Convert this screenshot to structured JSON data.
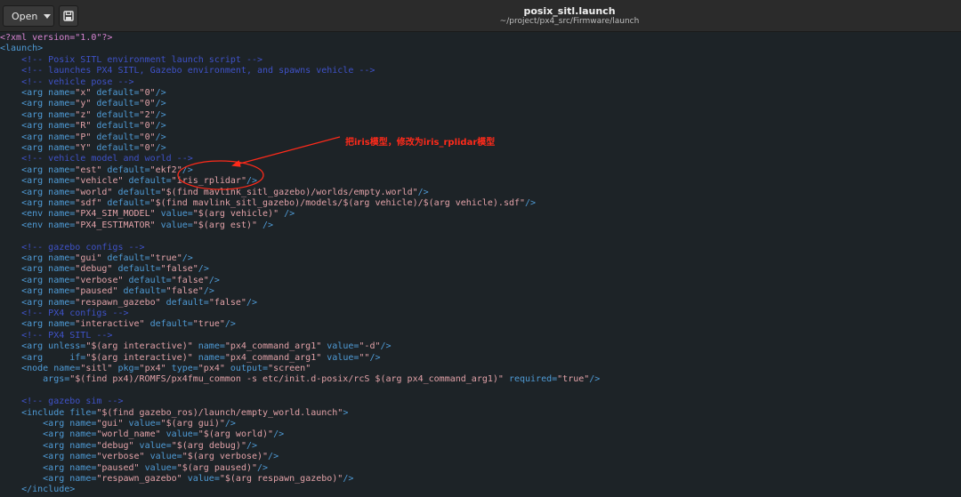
{
  "header": {
    "open_label": "Open",
    "save_icon": "save-icon",
    "title": "posix_sitl.launch",
    "subtitle": "~/project/px4_src/Firmware/launch"
  },
  "annotation": {
    "text": "把iris模型，修改为iris_rplidar模型",
    "color": "#ff2a1a"
  },
  "colors": {
    "background": "#1d2327",
    "tag": "#4f9bd6",
    "value": "#e2a2a8",
    "comment": "#3f52c8",
    "processing_instruction": "#d884d0"
  },
  "lines": [
    {
      "indent": 0,
      "tokens": [
        {
          "c": "pi",
          "t": "<?xml version=\"1.0\"?>"
        }
      ]
    },
    {
      "indent": 0,
      "tokens": [
        {
          "c": "tag",
          "t": "<launch>"
        }
      ]
    },
    {
      "indent": 4,
      "tokens": [
        {
          "c": "comment",
          "t": "<!-- Posix SITL environment launch script -->"
        }
      ]
    },
    {
      "indent": 4,
      "tokens": [
        {
          "c": "comment",
          "t": "<!-- launches PX4 SITL, Gazebo environment, and spawns vehicle -->"
        }
      ]
    },
    {
      "indent": 4,
      "tokens": [
        {
          "c": "comment",
          "t": "<!-- vehicle pose -->"
        }
      ]
    },
    {
      "indent": 4,
      "tokens": [
        {
          "c": "tag",
          "t": "<arg name="
        },
        {
          "c": "val",
          "t": "\"x\""
        },
        {
          "c": "tag",
          "t": " default="
        },
        {
          "c": "val",
          "t": "\"0\""
        },
        {
          "c": "tag",
          "t": "/>"
        }
      ]
    },
    {
      "indent": 4,
      "tokens": [
        {
          "c": "tag",
          "t": "<arg name="
        },
        {
          "c": "val",
          "t": "\"y\""
        },
        {
          "c": "tag",
          "t": " default="
        },
        {
          "c": "val",
          "t": "\"0\""
        },
        {
          "c": "tag",
          "t": "/>"
        }
      ]
    },
    {
      "indent": 4,
      "tokens": [
        {
          "c": "tag",
          "t": "<arg name="
        },
        {
          "c": "val",
          "t": "\"z\""
        },
        {
          "c": "tag",
          "t": " default="
        },
        {
          "c": "val",
          "t": "\"2\""
        },
        {
          "c": "tag",
          "t": "/>"
        }
      ]
    },
    {
      "indent": 4,
      "tokens": [
        {
          "c": "tag",
          "t": "<arg name="
        },
        {
          "c": "val",
          "t": "\"R\""
        },
        {
          "c": "tag",
          "t": " default="
        },
        {
          "c": "val",
          "t": "\"0\""
        },
        {
          "c": "tag",
          "t": "/>"
        }
      ]
    },
    {
      "indent": 4,
      "tokens": [
        {
          "c": "tag",
          "t": "<arg name="
        },
        {
          "c": "val",
          "t": "\"P\""
        },
        {
          "c": "tag",
          "t": " default="
        },
        {
          "c": "val",
          "t": "\"0\""
        },
        {
          "c": "tag",
          "t": "/>"
        }
      ]
    },
    {
      "indent": 4,
      "tokens": [
        {
          "c": "tag",
          "t": "<arg name="
        },
        {
          "c": "val",
          "t": "\"Y\""
        },
        {
          "c": "tag",
          "t": " default="
        },
        {
          "c": "val",
          "t": "\"0\""
        },
        {
          "c": "tag",
          "t": "/>"
        }
      ]
    },
    {
      "indent": 4,
      "tokens": [
        {
          "c": "comment",
          "t": "<!-- vehicle model and world -->"
        }
      ]
    },
    {
      "indent": 4,
      "tokens": [
        {
          "c": "tag",
          "t": "<arg name="
        },
        {
          "c": "val",
          "t": "\"est\""
        },
        {
          "c": "tag",
          "t": " default="
        },
        {
          "c": "val",
          "t": "\"ekf2\""
        },
        {
          "c": "tag",
          "t": "/>"
        }
      ]
    },
    {
      "indent": 4,
      "tokens": [
        {
          "c": "tag",
          "t": "<arg name="
        },
        {
          "c": "val",
          "t": "\"vehicle\""
        },
        {
          "c": "tag",
          "t": " default="
        },
        {
          "c": "val",
          "t": "\"iris_rplidar\""
        },
        {
          "c": "tag",
          "t": "/>"
        }
      ]
    },
    {
      "indent": 4,
      "tokens": [
        {
          "c": "tag",
          "t": "<arg name="
        },
        {
          "c": "val",
          "t": "\"world\""
        },
        {
          "c": "tag",
          "t": " default="
        },
        {
          "c": "val",
          "t": "\"$(find mavlink_sitl_gazebo)/worlds/empty.world\""
        },
        {
          "c": "tag",
          "t": "/>"
        }
      ]
    },
    {
      "indent": 4,
      "tokens": [
        {
          "c": "tag",
          "t": "<arg name="
        },
        {
          "c": "val",
          "t": "\"sdf\""
        },
        {
          "c": "tag",
          "t": " default="
        },
        {
          "c": "val",
          "t": "\"$(find mavlink_sitl_gazebo)/models/$(arg vehicle)/$(arg vehicle).sdf\""
        },
        {
          "c": "tag",
          "t": "/>"
        }
      ]
    },
    {
      "indent": 4,
      "tokens": [
        {
          "c": "tag",
          "t": "<env name="
        },
        {
          "c": "val",
          "t": "\"PX4_SIM_MODEL\""
        },
        {
          "c": "tag",
          "t": " value="
        },
        {
          "c": "val",
          "t": "\"$(arg vehicle)\""
        },
        {
          "c": "tag",
          "t": " />"
        }
      ]
    },
    {
      "indent": 4,
      "tokens": [
        {
          "c": "tag",
          "t": "<env name="
        },
        {
          "c": "val",
          "t": "\"PX4_ESTIMATOR\""
        },
        {
          "c": "tag",
          "t": " value="
        },
        {
          "c": "val",
          "t": "\"$(arg est)\""
        },
        {
          "c": "tag",
          "t": " />"
        }
      ]
    },
    {
      "indent": 0,
      "tokens": []
    },
    {
      "indent": 4,
      "tokens": [
        {
          "c": "comment",
          "t": "<!-- gazebo configs -->"
        }
      ]
    },
    {
      "indent": 4,
      "tokens": [
        {
          "c": "tag",
          "t": "<arg name="
        },
        {
          "c": "val",
          "t": "\"gui\""
        },
        {
          "c": "tag",
          "t": " default="
        },
        {
          "c": "val",
          "t": "\"true\""
        },
        {
          "c": "tag",
          "t": "/>"
        }
      ]
    },
    {
      "indent": 4,
      "tokens": [
        {
          "c": "tag",
          "t": "<arg name="
        },
        {
          "c": "val",
          "t": "\"debug\""
        },
        {
          "c": "tag",
          "t": " default="
        },
        {
          "c": "val",
          "t": "\"false\""
        },
        {
          "c": "tag",
          "t": "/>"
        }
      ]
    },
    {
      "indent": 4,
      "tokens": [
        {
          "c": "tag",
          "t": "<arg name="
        },
        {
          "c": "val",
          "t": "\"verbose\""
        },
        {
          "c": "tag",
          "t": " default="
        },
        {
          "c": "val",
          "t": "\"false\""
        },
        {
          "c": "tag",
          "t": "/>"
        }
      ]
    },
    {
      "indent": 4,
      "tokens": [
        {
          "c": "tag",
          "t": "<arg name="
        },
        {
          "c": "val",
          "t": "\"paused\""
        },
        {
          "c": "tag",
          "t": " default="
        },
        {
          "c": "val",
          "t": "\"false\""
        },
        {
          "c": "tag",
          "t": "/>"
        }
      ]
    },
    {
      "indent": 4,
      "tokens": [
        {
          "c": "tag",
          "t": "<arg name="
        },
        {
          "c": "val",
          "t": "\"respawn_gazebo\""
        },
        {
          "c": "tag",
          "t": " default="
        },
        {
          "c": "val",
          "t": "\"false\""
        },
        {
          "c": "tag",
          "t": "/>"
        }
      ]
    },
    {
      "indent": 4,
      "tokens": [
        {
          "c": "comment",
          "t": "<!-- PX4 configs -->"
        }
      ]
    },
    {
      "indent": 4,
      "tokens": [
        {
          "c": "tag",
          "t": "<arg name="
        },
        {
          "c": "val",
          "t": "\"interactive\""
        },
        {
          "c": "tag",
          "t": " default="
        },
        {
          "c": "val",
          "t": "\"true\""
        },
        {
          "c": "tag",
          "t": "/>"
        }
      ]
    },
    {
      "indent": 4,
      "tokens": [
        {
          "c": "comment",
          "t": "<!-- PX4 SITL -->"
        }
      ]
    },
    {
      "indent": 4,
      "tokens": [
        {
          "c": "tag",
          "t": "<arg unless="
        },
        {
          "c": "val",
          "t": "\"$(arg interactive)\""
        },
        {
          "c": "tag",
          "t": " name="
        },
        {
          "c": "val",
          "t": "\"px4_command_arg1\""
        },
        {
          "c": "tag",
          "t": " value="
        },
        {
          "c": "val",
          "t": "\"-d\""
        },
        {
          "c": "tag",
          "t": "/>"
        }
      ]
    },
    {
      "indent": 4,
      "tokens": [
        {
          "c": "tag",
          "t": "<arg     if="
        },
        {
          "c": "val",
          "t": "\"$(arg interactive)\""
        },
        {
          "c": "tag",
          "t": " name="
        },
        {
          "c": "val",
          "t": "\"px4_command_arg1\""
        },
        {
          "c": "tag",
          "t": " value="
        },
        {
          "c": "val",
          "t": "\"\""
        },
        {
          "c": "tag",
          "t": "/>"
        }
      ]
    },
    {
      "indent": 4,
      "tokens": [
        {
          "c": "tag",
          "t": "<node name="
        },
        {
          "c": "val",
          "t": "\"sitl\""
        },
        {
          "c": "tag",
          "t": " pkg="
        },
        {
          "c": "val",
          "t": "\"px4\""
        },
        {
          "c": "tag",
          "t": " type="
        },
        {
          "c": "val",
          "t": "\"px4\""
        },
        {
          "c": "tag",
          "t": " output="
        },
        {
          "c": "val",
          "t": "\"screen\""
        }
      ]
    },
    {
      "indent": 8,
      "tokens": [
        {
          "c": "tag",
          "t": "args="
        },
        {
          "c": "val",
          "t": "\"$(find px4)/ROMFS/px4fmu_common -s etc/init.d-posix/rcS $(arg px4_command_arg1)\""
        },
        {
          "c": "tag",
          "t": " required="
        },
        {
          "c": "val",
          "t": "\"true\""
        },
        {
          "c": "tag",
          "t": "/>"
        }
      ]
    },
    {
      "indent": 0,
      "tokens": []
    },
    {
      "indent": 4,
      "tokens": [
        {
          "c": "comment",
          "t": "<!-- gazebo sim -->"
        }
      ]
    },
    {
      "indent": 4,
      "tokens": [
        {
          "c": "tag",
          "t": "<include file="
        },
        {
          "c": "val",
          "t": "\"$(find gazebo_ros)/launch/empty_world.launch\""
        },
        {
          "c": "tag",
          "t": ">"
        }
      ]
    },
    {
      "indent": 8,
      "tokens": [
        {
          "c": "tag",
          "t": "<arg name="
        },
        {
          "c": "val",
          "t": "\"gui\""
        },
        {
          "c": "tag",
          "t": " value="
        },
        {
          "c": "val",
          "t": "\"$(arg gui)\""
        },
        {
          "c": "tag",
          "t": "/>"
        }
      ]
    },
    {
      "indent": 8,
      "tokens": [
        {
          "c": "tag",
          "t": "<arg name="
        },
        {
          "c": "val",
          "t": "\"world_name\""
        },
        {
          "c": "tag",
          "t": " value="
        },
        {
          "c": "val",
          "t": "\"$(arg world)\""
        },
        {
          "c": "tag",
          "t": "/>"
        }
      ]
    },
    {
      "indent": 8,
      "tokens": [
        {
          "c": "tag",
          "t": "<arg name="
        },
        {
          "c": "val",
          "t": "\"debug\""
        },
        {
          "c": "tag",
          "t": " value="
        },
        {
          "c": "val",
          "t": "\"$(arg debug)\""
        },
        {
          "c": "tag",
          "t": "/>"
        }
      ]
    },
    {
      "indent": 8,
      "tokens": [
        {
          "c": "tag",
          "t": "<arg name="
        },
        {
          "c": "val",
          "t": "\"verbose\""
        },
        {
          "c": "tag",
          "t": " value="
        },
        {
          "c": "val",
          "t": "\"$(arg verbose)\""
        },
        {
          "c": "tag",
          "t": "/>"
        }
      ]
    },
    {
      "indent": 8,
      "tokens": [
        {
          "c": "tag",
          "t": "<arg name="
        },
        {
          "c": "val",
          "t": "\"paused\""
        },
        {
          "c": "tag",
          "t": " value="
        },
        {
          "c": "val",
          "t": "\"$(arg paused)\""
        },
        {
          "c": "tag",
          "t": "/>"
        }
      ]
    },
    {
      "indent": 8,
      "tokens": [
        {
          "c": "tag",
          "t": "<arg name="
        },
        {
          "c": "val",
          "t": "\"respawn_gazebo\""
        },
        {
          "c": "tag",
          "t": " value="
        },
        {
          "c": "val",
          "t": "\"$(arg respawn_gazebo)\""
        },
        {
          "c": "tag",
          "t": "/>"
        }
      ]
    },
    {
      "indent": 4,
      "tokens": [
        {
          "c": "tag",
          "t": "</include>"
        }
      ]
    }
  ]
}
